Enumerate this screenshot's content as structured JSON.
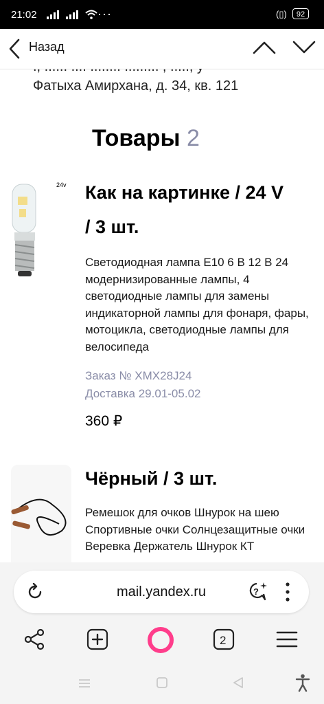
{
  "status_bar": {
    "time": "21:02",
    "battery": "92"
  },
  "nav": {
    "back_label": "Назад"
  },
  "content": {
    "address_partial": "Фатыха Амирхана, д. 34, кв. 121",
    "address_cut_line": "., ...... .... ........ ......... , ....., у",
    "section_title": "Товары",
    "section_count": "2",
    "items": [
      {
        "title_line1": "Как на картинке / 24 V",
        "title_line2": "/ 3 шт.",
        "thumb_label": "24v",
        "description": "Светодиодная лампа E10 6 В 12 В 24 модернизированные лампы, 4 светодиодные лампы для замены индикаторной лампы для фонаря, фары, мотоцикла, светодиодные лампы для велосипеда",
        "order": "Заказ № XMX28J24",
        "delivery": "Доставка 29.01-05.02",
        "price": "360 ₽"
      },
      {
        "title_line1": "Чёрный / 3 шт.",
        "description": "Ремешок для очков Шнурок на шею Спортивные очки Солнцезащитные очки Веревка Держатель Шнурок КТ"
      }
    ]
  },
  "browser": {
    "url": "mail.yandex.ru",
    "tab_count": "2",
    "alice_color": "#ff3d8b"
  }
}
